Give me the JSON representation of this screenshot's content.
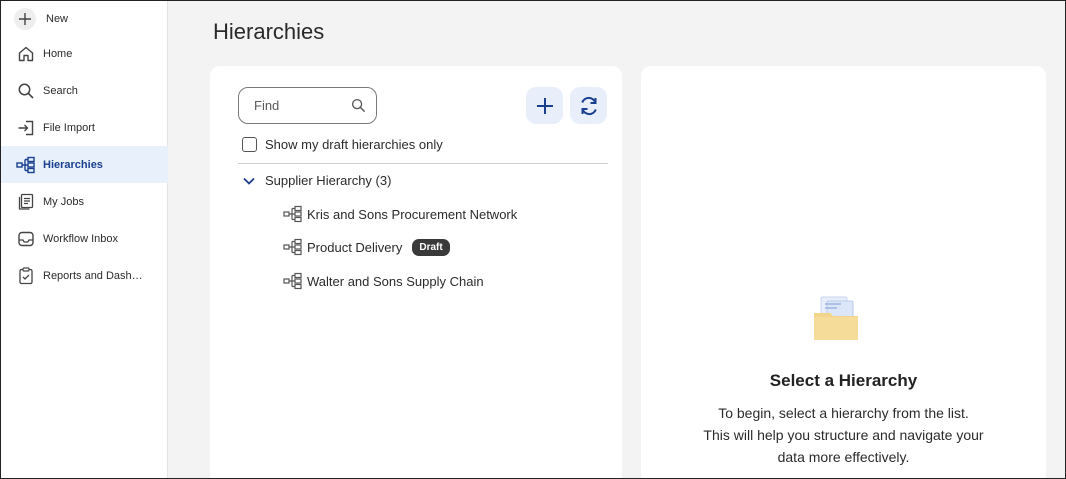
{
  "sidebar": {
    "new_label": "New",
    "items": [
      {
        "label": "Home",
        "icon": "home-icon"
      },
      {
        "label": "Search",
        "icon": "search-icon"
      },
      {
        "label": "File Import",
        "icon": "file-import-icon"
      },
      {
        "label": "Hierarchies",
        "icon": "hierarchy-icon",
        "active": true
      },
      {
        "label": "My Jobs",
        "icon": "jobs-icon"
      },
      {
        "label": "Workflow Inbox",
        "icon": "inbox-icon"
      },
      {
        "label": "Reports and Dash…",
        "icon": "report-icon"
      }
    ]
  },
  "page": {
    "title": "Hierarchies"
  },
  "list_panel": {
    "search_placeholder": "Find",
    "draft_filter_label": "Show my draft hierarchies only",
    "draft_filter_checked": false,
    "group": {
      "label": "Supplier Hierarchy (3)",
      "expanded": true,
      "items": [
        {
          "label": "Kris and Sons Procurement Network",
          "badge": ""
        },
        {
          "label": "Product Delivery",
          "badge": "Draft"
        },
        {
          "label": "Walter and Sons Supply Chain",
          "badge": ""
        }
      ]
    }
  },
  "detail_panel": {
    "title": "Select a Hierarchy",
    "line1": "To begin, select a hierarchy from the list.",
    "line2": "This will help you structure and navigate your",
    "line3": "data more effectively."
  },
  "colors": {
    "accent": "#1a3f8f",
    "active_bg": "#e8f0fb",
    "badge_bg": "#3a3a3a",
    "folder": "#f2d58a"
  }
}
